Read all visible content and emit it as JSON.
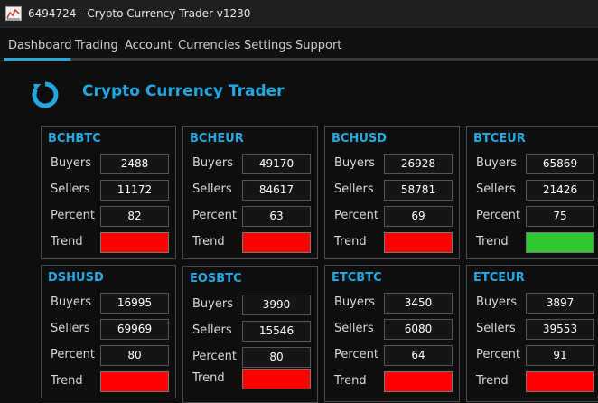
{
  "window": {
    "title": "6494724 - Crypto Currency Trader v1230"
  },
  "menu": [
    "Dashboard",
    "Trading",
    "Account",
    "Currencies",
    "Settings",
    "Support"
  ],
  "app": {
    "title": "Crypto Currency Trader"
  },
  "labels": {
    "buyers": "Buyers",
    "sellers": "Sellers",
    "percent": "Percent",
    "trend": "Trend"
  },
  "colors": {
    "up": "#31c931",
    "down": "#ff0000",
    "accent": "#23a7e0"
  },
  "cards": [
    {
      "name": "BCHBTC",
      "buyers": "2488",
      "sellers": "11172",
      "percent": "82",
      "trend": "down"
    },
    {
      "name": "BCHEUR",
      "buyers": "49170",
      "sellers": "84617",
      "percent": "63",
      "trend": "down"
    },
    {
      "name": "BCHUSD",
      "buyers": "26928",
      "sellers": "58781",
      "percent": "69",
      "trend": "down"
    },
    {
      "name": "BTCEUR",
      "buyers": "65869",
      "sellers": "21426",
      "percent": "75",
      "trend": "up"
    },
    {
      "name": "DSHUSD",
      "buyers": "16995",
      "sellers": "69969",
      "percent": "80",
      "trend": "down"
    },
    {
      "name": "EOSBTC",
      "buyers": "3990",
      "sellers": "15546",
      "percent": "80",
      "trend": "down"
    },
    {
      "name": "ETCBTC",
      "buyers": "3450",
      "sellers": "6080",
      "percent": "64",
      "trend": "down"
    },
    {
      "name": "ETCEUR",
      "buyers": "3897",
      "sellers": "39553",
      "percent": "91",
      "trend": "down"
    }
  ]
}
